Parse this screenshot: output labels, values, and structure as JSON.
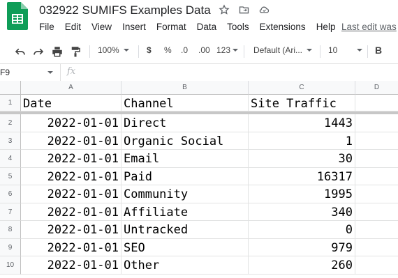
{
  "doc": {
    "title": "032922 SUMIFS Examples Data",
    "last_edit": "Last edit was"
  },
  "menu": [
    "File",
    "Edit",
    "View",
    "Insert",
    "Format",
    "Data",
    "Tools",
    "Extensions",
    "Help"
  ],
  "toolbar": {
    "zoom": "100%",
    "currency": "$",
    "percent": "%",
    "decrease_decimal": ".0",
    "increase_decimal": ".00",
    "more_formats": "123",
    "font": "Default (Ari...",
    "font_size": "10",
    "bold": "B"
  },
  "formula_bar": {
    "cell_ref": "F9",
    "fx": "fx",
    "content": ""
  },
  "columns": [
    "A",
    "B",
    "C",
    "D"
  ],
  "rows": [
    {
      "num": "1",
      "a": "Date",
      "b": "Channel",
      "c": "Site Traffic"
    },
    {
      "num": "2",
      "a": "2022-01-01",
      "b": "Direct",
      "c": "1443"
    },
    {
      "num": "3",
      "a": "2022-01-01",
      "b": "Organic Social",
      "c": "1"
    },
    {
      "num": "4",
      "a": "2022-01-01",
      "b": "Email",
      "c": "30"
    },
    {
      "num": "5",
      "a": "2022-01-01",
      "b": "Paid",
      "c": "16317"
    },
    {
      "num": "6",
      "a": "2022-01-01",
      "b": "Community",
      "c": "1995"
    },
    {
      "num": "7",
      "a": "2022-01-01",
      "b": "Affiliate",
      "c": "340"
    },
    {
      "num": "8",
      "a": "2022-01-01",
      "b": "Untracked",
      "c": "0"
    },
    {
      "num": "9",
      "a": "2022-01-01",
      "b": "SEO",
      "c": "979"
    },
    {
      "num": "10",
      "a": "2022-01-01",
      "b": "Other",
      "c": "260"
    }
  ],
  "colors": {
    "sheets_green": "#0f9d58",
    "header_bg": "#f8f9fa",
    "freeze_bar": "#c7c7c7"
  }
}
